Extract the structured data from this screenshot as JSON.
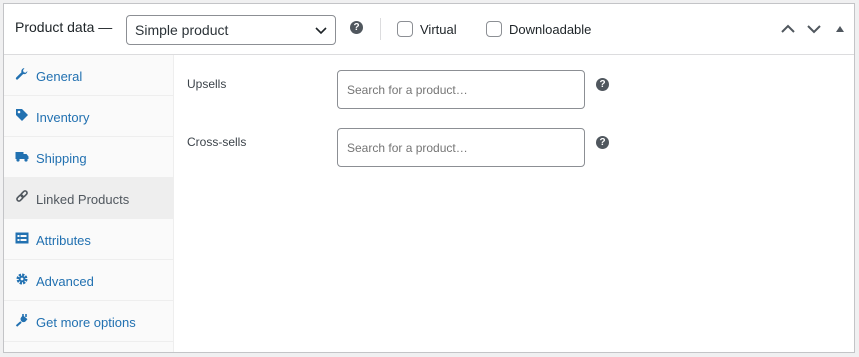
{
  "header": {
    "title": "Product data —",
    "product_type": "Simple product",
    "help_glyph": "?",
    "virtual_label": "Virtual",
    "downloadable_label": "Downloadable",
    "virtual_checked": false,
    "downloadable_checked": false
  },
  "tabs": [
    {
      "label": "General",
      "icon": "wrench-icon",
      "active": false
    },
    {
      "label": "Inventory",
      "icon": "tag-icon",
      "active": false
    },
    {
      "label": "Shipping",
      "icon": "truck-icon",
      "active": false
    },
    {
      "label": "Linked Products",
      "icon": "link-icon",
      "active": true
    },
    {
      "label": "Attributes",
      "icon": "list-icon",
      "active": false
    },
    {
      "label": "Advanced",
      "icon": "gear-icon",
      "active": false
    },
    {
      "label": "Get more options",
      "icon": "plug-icon",
      "active": false
    }
  ],
  "linked": {
    "upsells": {
      "label": "Upsells",
      "placeholder": "Search for a product…"
    },
    "cross_sells": {
      "label": "Cross-sells",
      "placeholder": "Search for a product…"
    }
  },
  "colors": {
    "link": "#2271b1",
    "active_tab_bg": "#eeeeee",
    "border": "#8c8f94"
  }
}
